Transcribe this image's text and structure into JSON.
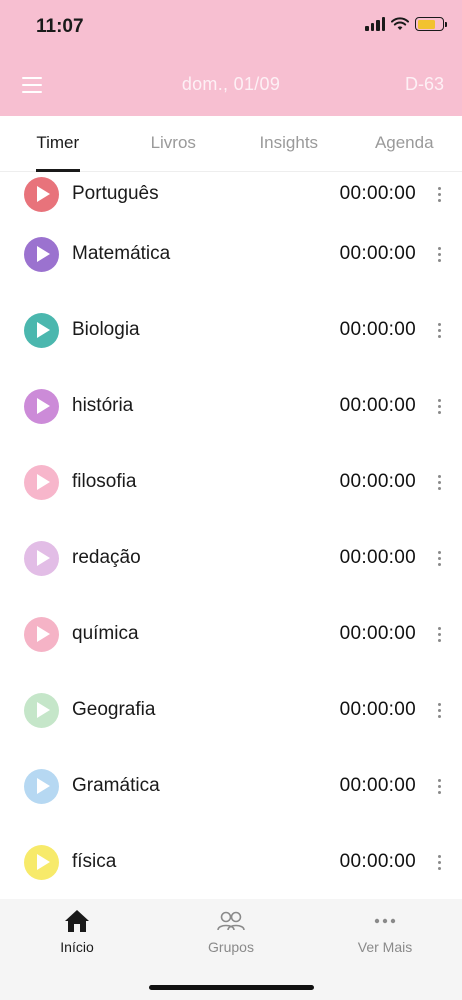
{
  "status_bar": {
    "time": "11:07"
  },
  "header": {
    "date": "dom., 01/09",
    "dday": "D-63"
  },
  "tabs": [
    {
      "label": "Timer",
      "active": true
    },
    {
      "label": "Livros",
      "active": false
    },
    {
      "label": "Insights",
      "active": false
    },
    {
      "label": "Agenda",
      "active": false
    }
  ],
  "subjects": [
    {
      "name": "Português",
      "time": "00:00:00",
      "color": "#e8737b"
    },
    {
      "name": "Matemática",
      "time": "00:00:00",
      "color": "#9b72cf"
    },
    {
      "name": "Biologia",
      "time": "00:00:00",
      "color": "#4bb7ae"
    },
    {
      "name": "história",
      "time": "00:00:00",
      "color": "#cc8bd8"
    },
    {
      "name": "filosofia",
      "time": "00:00:00",
      "color": "#f7b6cb"
    },
    {
      "name": "redação",
      "time": "00:00:00",
      "color": "#e2bde6"
    },
    {
      "name": "química",
      "time": "00:00:00",
      "color": "#f5b3c6"
    },
    {
      "name": "Geografia",
      "time": "00:00:00",
      "color": "#c5e6c9"
    },
    {
      "name": "Gramática",
      "time": "00:00:00",
      "color": "#b6d8f2"
    },
    {
      "name": "física",
      "time": "00:00:00",
      "color": "#f7ea6a"
    }
  ],
  "bottom_nav": [
    {
      "label": "Início",
      "icon": "home-icon",
      "active": true
    },
    {
      "label": "Grupos",
      "icon": "group-icon",
      "active": false
    },
    {
      "label": "Ver Mais",
      "icon": "more-horizontal-icon",
      "active": false
    }
  ],
  "colors": {
    "header_bg": "#f7bfd1",
    "battery": "#f2c230"
  }
}
